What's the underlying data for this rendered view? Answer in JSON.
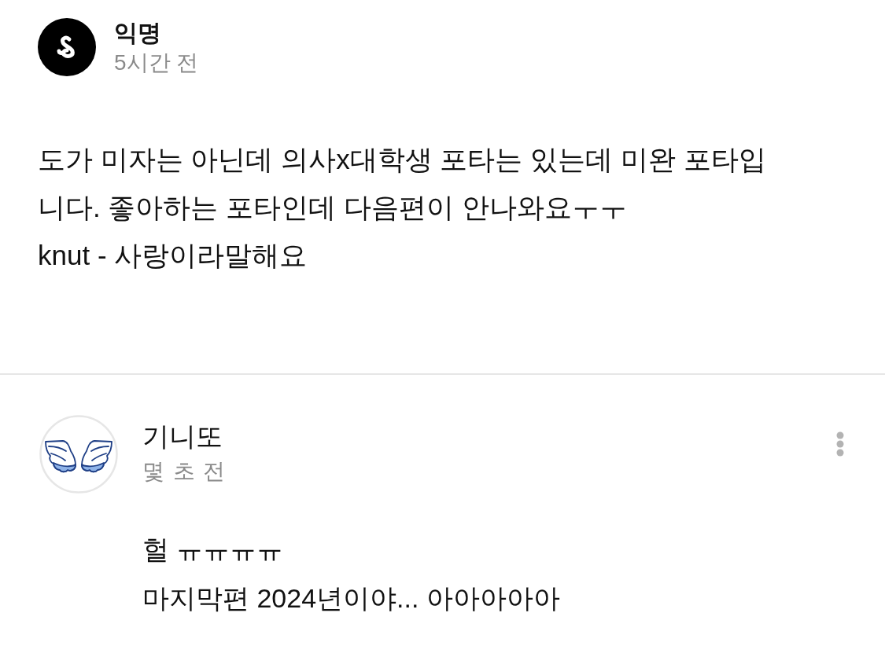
{
  "post": {
    "author": {
      "name": "익명",
      "time": "5시간 전"
    },
    "body": [
      "도가 미자는 아닌데 의사x대학생 포타는 있는데 미완 포타입",
      "니다. 좋아하는 포타인데 다음편이 안나와요ㅜㅜ",
      "knut - 사랑이라말해요"
    ]
  },
  "comments": [
    {
      "author": {
        "name": "기니또",
        "time": "몇 초 전"
      },
      "body": [
        "헐 ㅠㅠㅠㅠ",
        "마지막편 2024년이야... 아아아아아"
      ]
    }
  ]
}
